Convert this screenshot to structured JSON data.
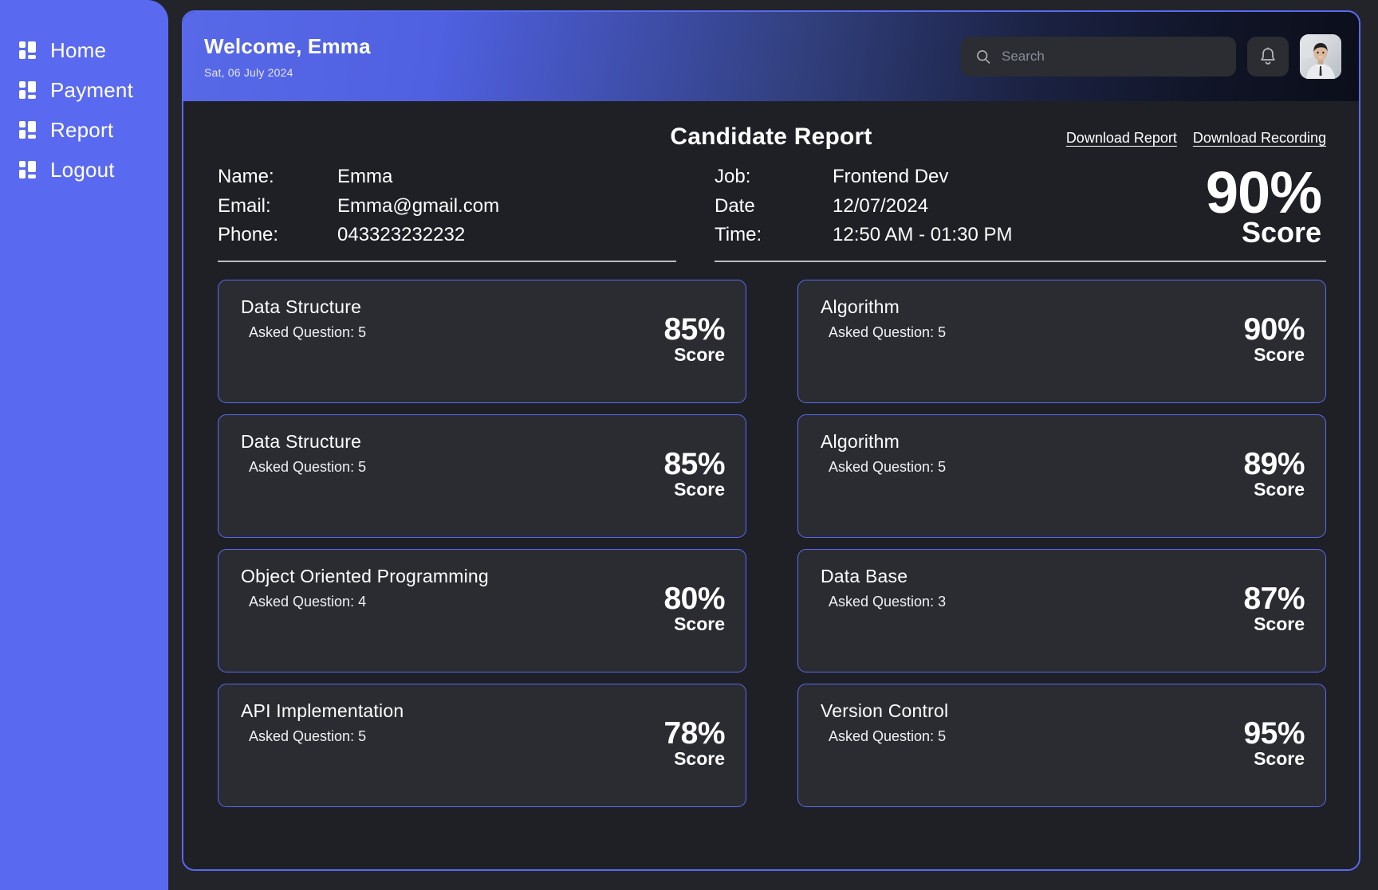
{
  "theme": {
    "accent": "#5a6af0",
    "page_bg": "#22242a",
    "panel_bg": "#1e2026",
    "card_bg": "#2a2c32",
    "text": "#ffffff"
  },
  "sidebar": {
    "items": [
      {
        "label": "Home",
        "icon": "grid-icon"
      },
      {
        "label": "Payment",
        "icon": "grid-icon"
      },
      {
        "label": "Report",
        "icon": "grid-icon"
      },
      {
        "label": "Logout",
        "icon": "grid-icon"
      }
    ]
  },
  "topbar": {
    "welcome": "Welcome, Emma",
    "date": "Sat, 06 July 2024",
    "search": {
      "value": "",
      "placeholder": "Search",
      "icon": "search-icon"
    },
    "notification_icon": "bell-icon",
    "avatar_icon": "user-avatar"
  },
  "report": {
    "title": "Candidate Report",
    "download_report_label": "Download Report",
    "download_recording_label": "Download Recording",
    "info_left": {
      "keys": [
        "Name:",
        "Email:",
        "Phone:"
      ],
      "values": [
        "Emma",
        "Emma@gmail.com",
        "043323232232"
      ]
    },
    "info_right": {
      "keys": [
        "Job:",
        "Date",
        "Time:"
      ],
      "values": [
        "Frontend Dev",
        "12/07/2024",
        "12:50 AM - 01:30 PM"
      ]
    },
    "overall_score": {
      "value": "90%",
      "label": "Score"
    },
    "score_suffix": "Score",
    "skills_left": [
      {
        "name": "Data Structure",
        "questions": "Asked Question: 5",
        "score": "85%",
        "label": "Score"
      },
      {
        "name": "Data Structure",
        "questions": "Asked Question: 5",
        "score": "85%",
        "label": "Score"
      },
      {
        "name": "Object Oriented Programming",
        "questions": "Asked Question: 4",
        "score": "80%",
        "label": "Score"
      },
      {
        "name": "API Implementation",
        "questions": "Asked Question: 5",
        "score": "78%",
        "label": "Score"
      }
    ],
    "skills_right": [
      {
        "name": "Algorithm",
        "questions": "Asked Question: 5",
        "score": "90%",
        "label": "Score"
      },
      {
        "name": "Algorithm",
        "questions": "Asked Question: 5",
        "score": "89%",
        "label": "Score"
      },
      {
        "name": "Data Base",
        "questions": "Asked Question: 3",
        "score": "87%",
        "label": "Score"
      },
      {
        "name": "Version Control",
        "questions": "Asked Question: 5",
        "score": "95%",
        "label": "Score"
      }
    ]
  }
}
